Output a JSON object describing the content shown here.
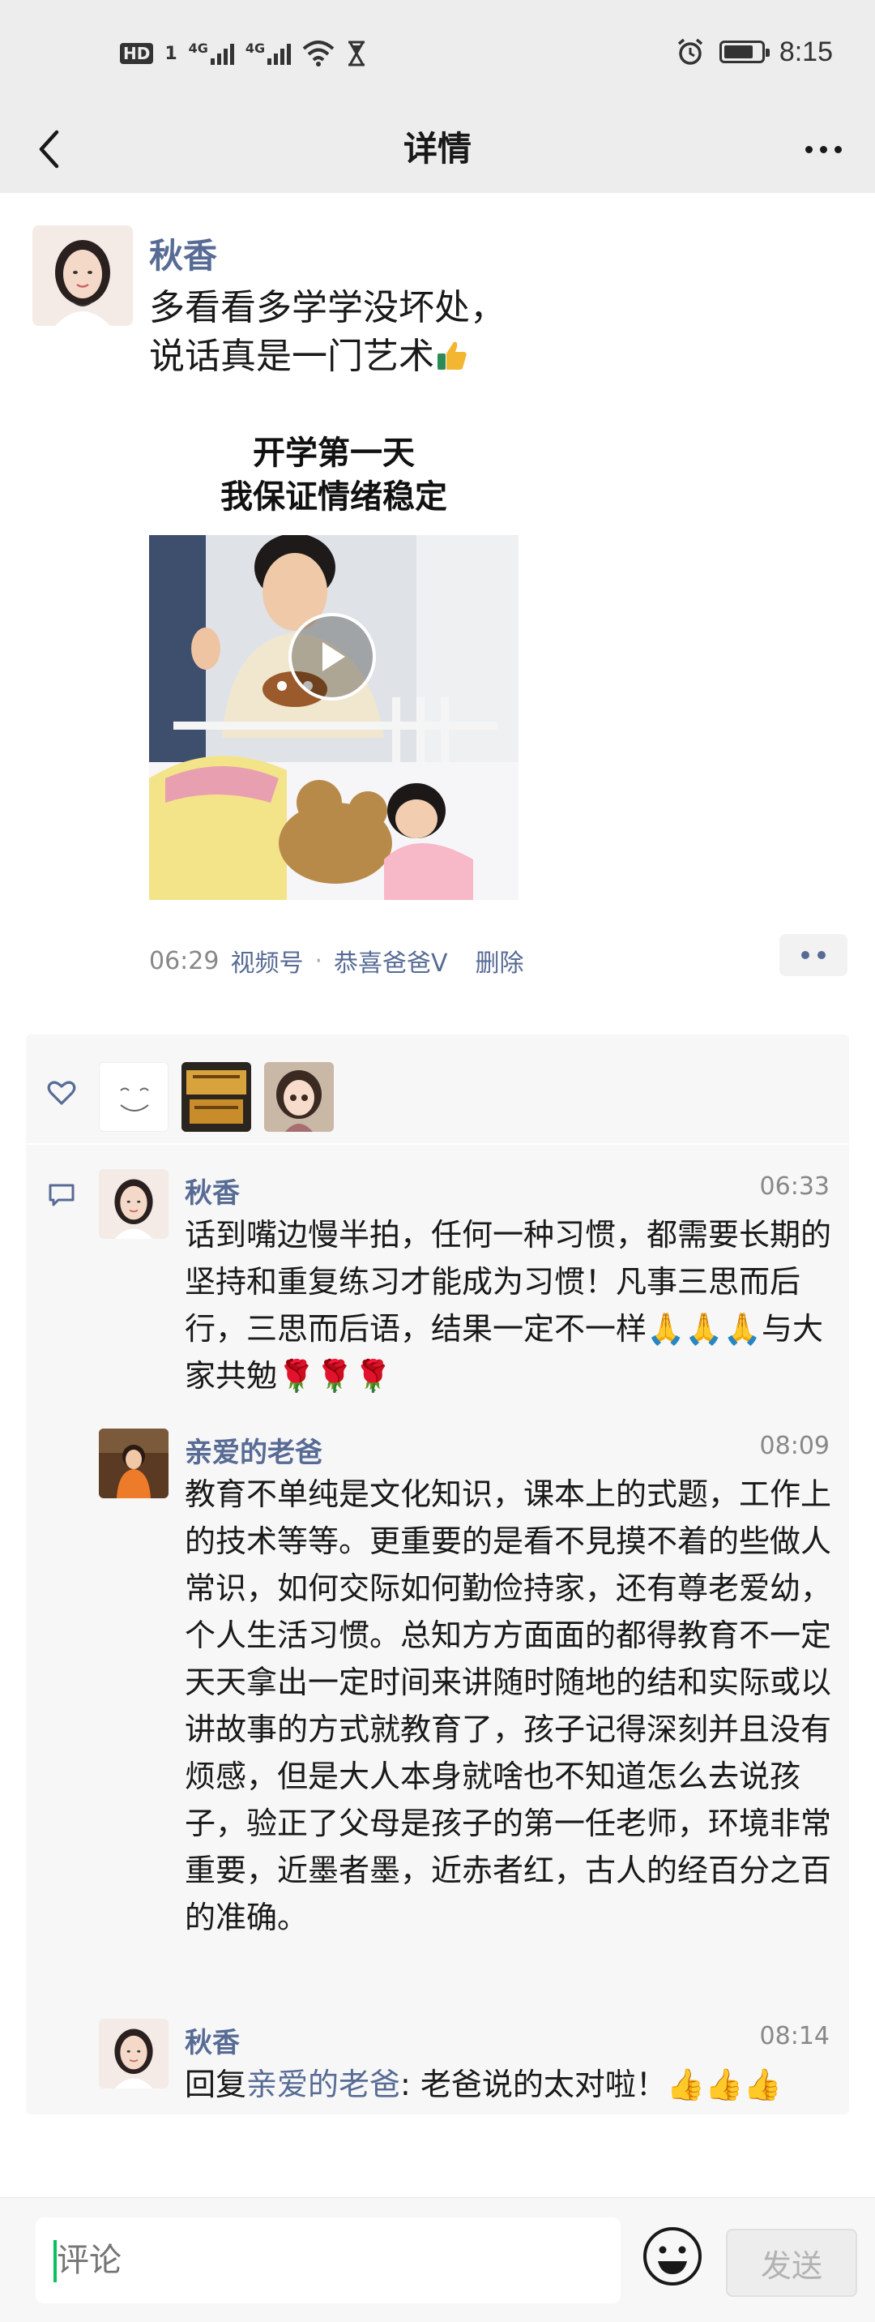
{
  "status_bar": {
    "hd": "HD",
    "sim": "1",
    "net1": "4G",
    "net2": "4G",
    "time": "8:15",
    "battery_level": 0.8
  },
  "nav": {
    "title": "详情"
  },
  "post": {
    "author": "秋香",
    "text_line1": "多看看多学学没坏处，",
    "text_line2": "说话真是一门艺术",
    "video_caption_line1": "开学第一天",
    "video_caption_line2": "我保证情绪稳定",
    "time": "06:29",
    "channel_label": "视频号",
    "separator": "·",
    "channel_author": "恭喜爸爸V",
    "delete_label": "删除"
  },
  "comments": [
    {
      "author": "秋香",
      "time": "06:33",
      "text": "话到嘴边慢半拍，任何一种习惯，都需要长期的坚持和重复练习才能成为习惯！凡事三思而后行，三思而后语，结果一定不一样🙏🙏🙏与大家共勉🌹🌹🌹"
    },
    {
      "author": "亲爱的老爸",
      "time": "08:09",
      "text": "教育不单纯是文化知识，课本上的式题，工作上的技术等等。更重要的是看不見摸不着的些做人常识，如何交际如何勤俭持家，还有尊老爱幼，个人生活习惯。总知方方面面的都得教育不一定天天拿出一定时间来讲随时随地的结和实际或以讲故事的方式就教育了，孩子记得深刻并且没有烦感，但是大人本身就啥也不知道怎么去说孩子，验正了父母是孩子的第一任老师，环境非常重要，近墨者墨，近赤者红，古人的经百分之百的准确。"
    },
    {
      "author": "秋香",
      "time": "08:14",
      "reply_prefix": "回复",
      "reply_to": "亲爱的老爸",
      "text": ": 老爸说的太对啦！👍👍👍"
    }
  ],
  "bottom": {
    "placeholder": "评论",
    "send_label": "发送"
  },
  "colors": {
    "link": "#576b95",
    "accent": "#07c160",
    "nav_bg": "#ededed"
  }
}
